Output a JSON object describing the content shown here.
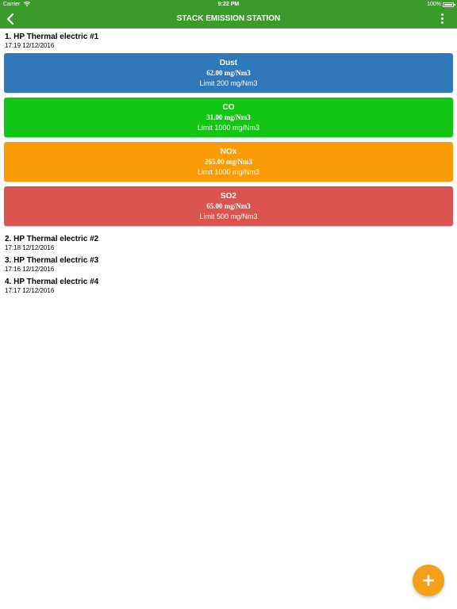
{
  "status_bar": {
    "carrier": "Carrier",
    "time": "9:22 PM",
    "battery": "100%"
  },
  "nav": {
    "title": "STACK EMISSION STATION",
    "back_icon": "chevron-left-icon",
    "menu_icon": "more-vertical-icon"
  },
  "stations": [
    {
      "name": "1. HP Thermal electric #1",
      "time": "17:19 12/12/2016",
      "readings": [
        {
          "pollutant": "Dust",
          "value": "62.00 mg/Nm3",
          "limit": "Limit 200 mg/Nm3",
          "color": "#3178b9"
        },
        {
          "pollutant": "CO",
          "value": "31.00 mg/Nm3",
          "limit": "Limit 1000 mg/Nm3",
          "color": "#13c514"
        },
        {
          "pollutant": "NOx",
          "value": "265.00 mg/Nm3",
          "limit": "Limit 1000 mg/Nm3",
          "color": "#fb9b06"
        },
        {
          "pollutant": "SO2",
          "value": "65.00 mg/Nm3",
          "limit": "Limit 500 mg/Nm3",
          "color": "#d9534f"
        }
      ]
    },
    {
      "name": "2. HP Thermal electric #2",
      "time": "17:18 12/12/2016"
    },
    {
      "name": "3. HP Thermal electric #3",
      "time": "17:16 12/12/2016"
    },
    {
      "name": "4. HP Thermal electric #4",
      "time": "17:17 12/12/2016"
    }
  ],
  "fab": {
    "icon": "plus-icon",
    "color": "#f5a01a"
  },
  "colors": {
    "brand": "#3a9a2a"
  }
}
